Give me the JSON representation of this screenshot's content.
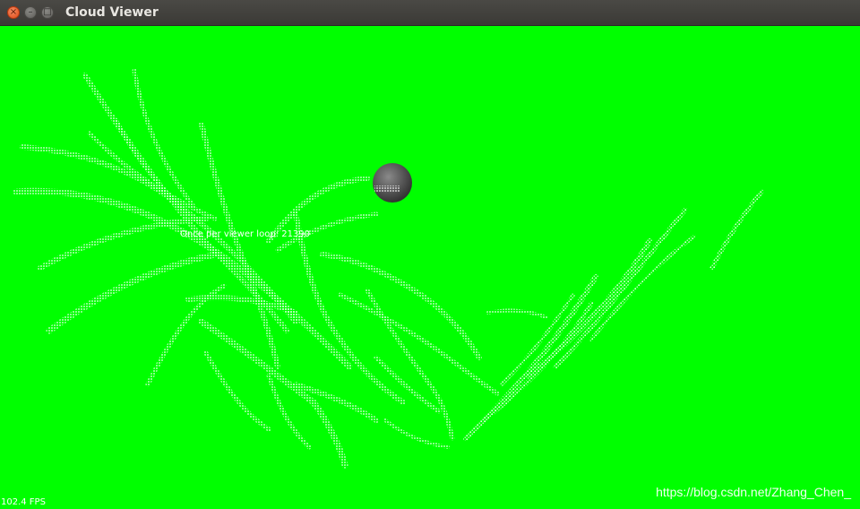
{
  "window": {
    "title": "Cloud Viewer",
    "buttons": {
      "close_glyph": "×",
      "minimize_glyph": "–",
      "maximize_glyph": "□"
    }
  },
  "viewport": {
    "background_color": "#00ff00",
    "point_color": "#ffffff",
    "sphere_color": "#555555",
    "overlay_text": "Once per viewer loop: 21390",
    "fps_text": "102.4 FPS",
    "watermark": "https://blog.csdn.net/Zhang_Chen_"
  }
}
